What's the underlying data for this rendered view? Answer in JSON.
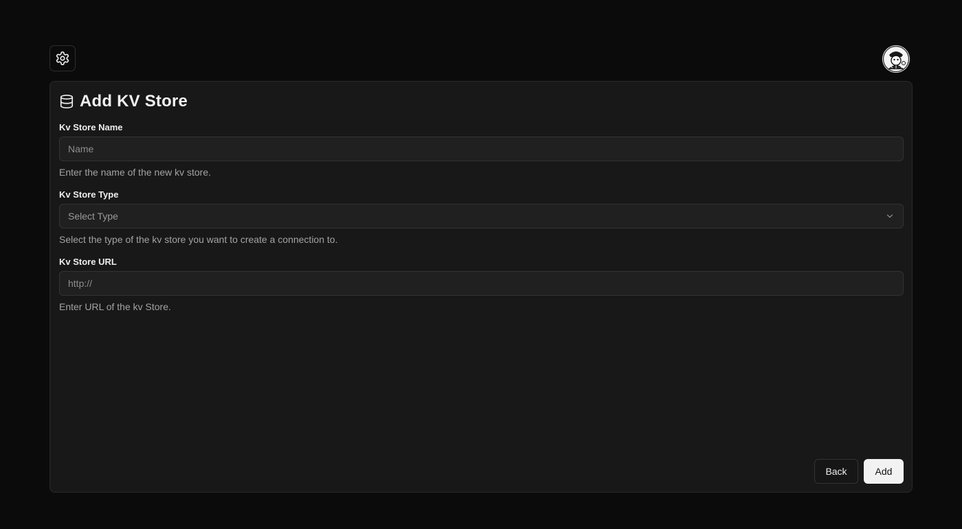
{
  "header": {
    "settings_icon": "gear-icon",
    "avatar_icon": "user-avatar"
  },
  "form": {
    "title_icon": "database-icon",
    "title": "Add KV Store",
    "name": {
      "label": "Kv Store Name",
      "value": "",
      "placeholder": "Name",
      "help": "Enter the name of the new kv store."
    },
    "type": {
      "label": "Kv Store Type",
      "selected": "Select Type",
      "help": "Select the type of the kv store you want to create a connection to."
    },
    "url": {
      "label": "Kv Store URL",
      "value": "",
      "placeholder": "http://",
      "help": "Enter URL of the kv Store."
    }
  },
  "actions": {
    "back_label": "Back",
    "add_label": "Add"
  },
  "colors": {
    "background": "#0b0b0b",
    "card": "#181818",
    "primary_button": "#f2f2f2"
  }
}
